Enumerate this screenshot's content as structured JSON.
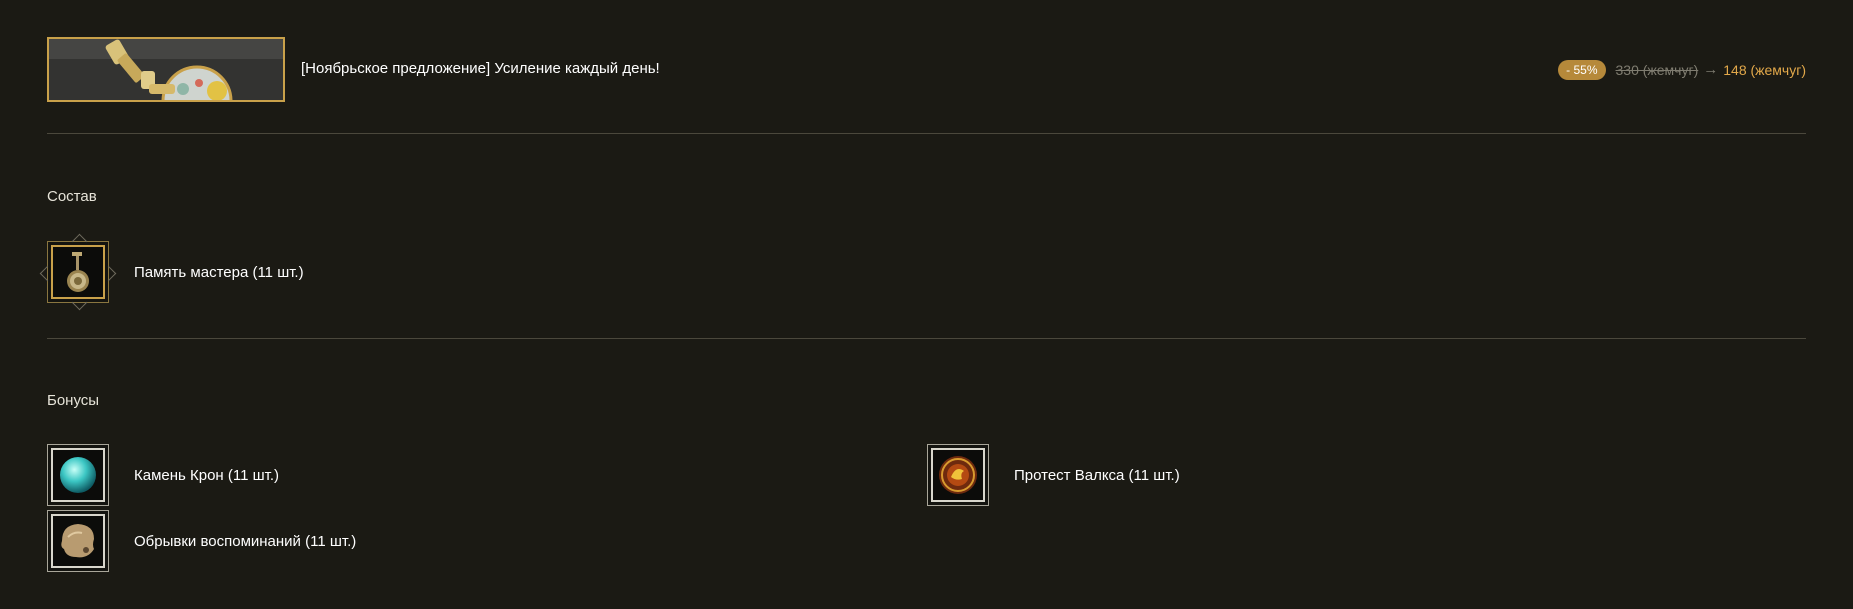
{
  "product": {
    "title": "[Ноябрьское предложение] Усиление каждый день!",
    "image_icon": "artifact-pendant-icon"
  },
  "price": {
    "discount": "- 55%",
    "old": "330 (жемчуг)",
    "arrow": "→",
    "new": "148 (жемчуг)"
  },
  "composition": {
    "title": "Состав",
    "items": [
      {
        "label": "Память мастера (11 шт.)",
        "icon": "master-memory-icon"
      }
    ]
  },
  "bonuses": {
    "title": "Бонусы",
    "items": [
      {
        "label": "Камень Крон (11 шт.)",
        "icon": "cron-stone-icon"
      },
      {
        "label": "Протест Валкса (11 шт.)",
        "icon": "valks-cry-icon"
      },
      {
        "label": "Обрывки воспоминаний (11 шт.)",
        "icon": "memory-fragment-icon"
      }
    ]
  },
  "colors": {
    "background": "#1b1a14",
    "accent_gold": "#c9a14a",
    "new_price": "#e2a84a",
    "badge": "#b6893a"
  }
}
